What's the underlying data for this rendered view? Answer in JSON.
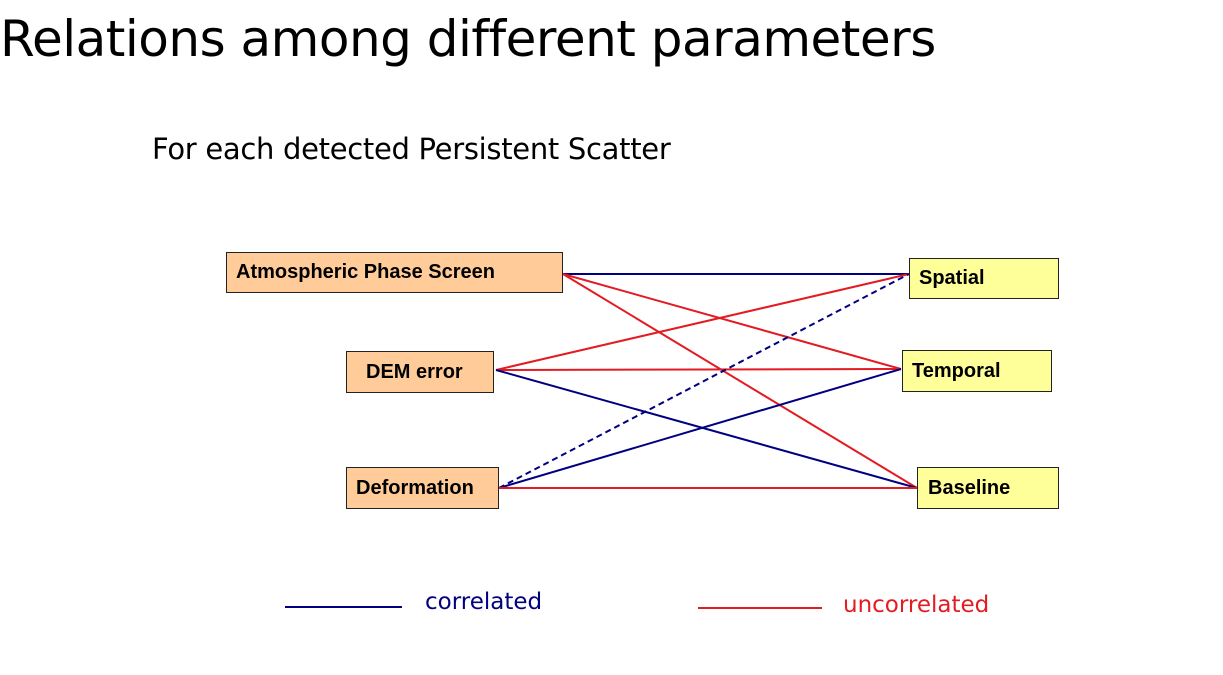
{
  "title": "Relations among different parameters",
  "subtitle": "For each detected Persistent Scatter",
  "colors": {
    "correlated": "#000080",
    "uncorrelated": "#e31b23",
    "param_fill": "#ffcc99",
    "factor_fill": "#ffff99"
  },
  "parameters": [
    {
      "id": "aps",
      "label": "Atmospheric Phase Screen"
    },
    {
      "id": "dem",
      "label": "DEM error"
    },
    {
      "id": "def",
      "label": "Deformation"
    }
  ],
  "factors": [
    {
      "id": "spatial",
      "label": "Spatial"
    },
    {
      "id": "temporal",
      "label": "Temporal"
    },
    {
      "id": "baseline",
      "label": "Baseline"
    }
  ],
  "edges": [
    {
      "from": "aps",
      "to": "spatial",
      "relation": "correlated"
    },
    {
      "from": "aps",
      "to": "temporal",
      "relation": "uncorrelated"
    },
    {
      "from": "aps",
      "to": "baseline",
      "relation": "uncorrelated"
    },
    {
      "from": "dem",
      "to": "spatial",
      "relation": "uncorrelated"
    },
    {
      "from": "dem",
      "to": "temporal",
      "relation": "uncorrelated"
    },
    {
      "from": "dem",
      "to": "baseline",
      "relation": "correlated"
    },
    {
      "from": "def",
      "to": "spatial",
      "relation": "correlated",
      "style": "dashed"
    },
    {
      "from": "def",
      "to": "temporal",
      "relation": "correlated"
    },
    {
      "from": "def",
      "to": "baseline",
      "relation": "uncorrelated"
    }
  ],
  "legend": {
    "correlated": "correlated",
    "uncorrelated": "uncorrelated"
  }
}
